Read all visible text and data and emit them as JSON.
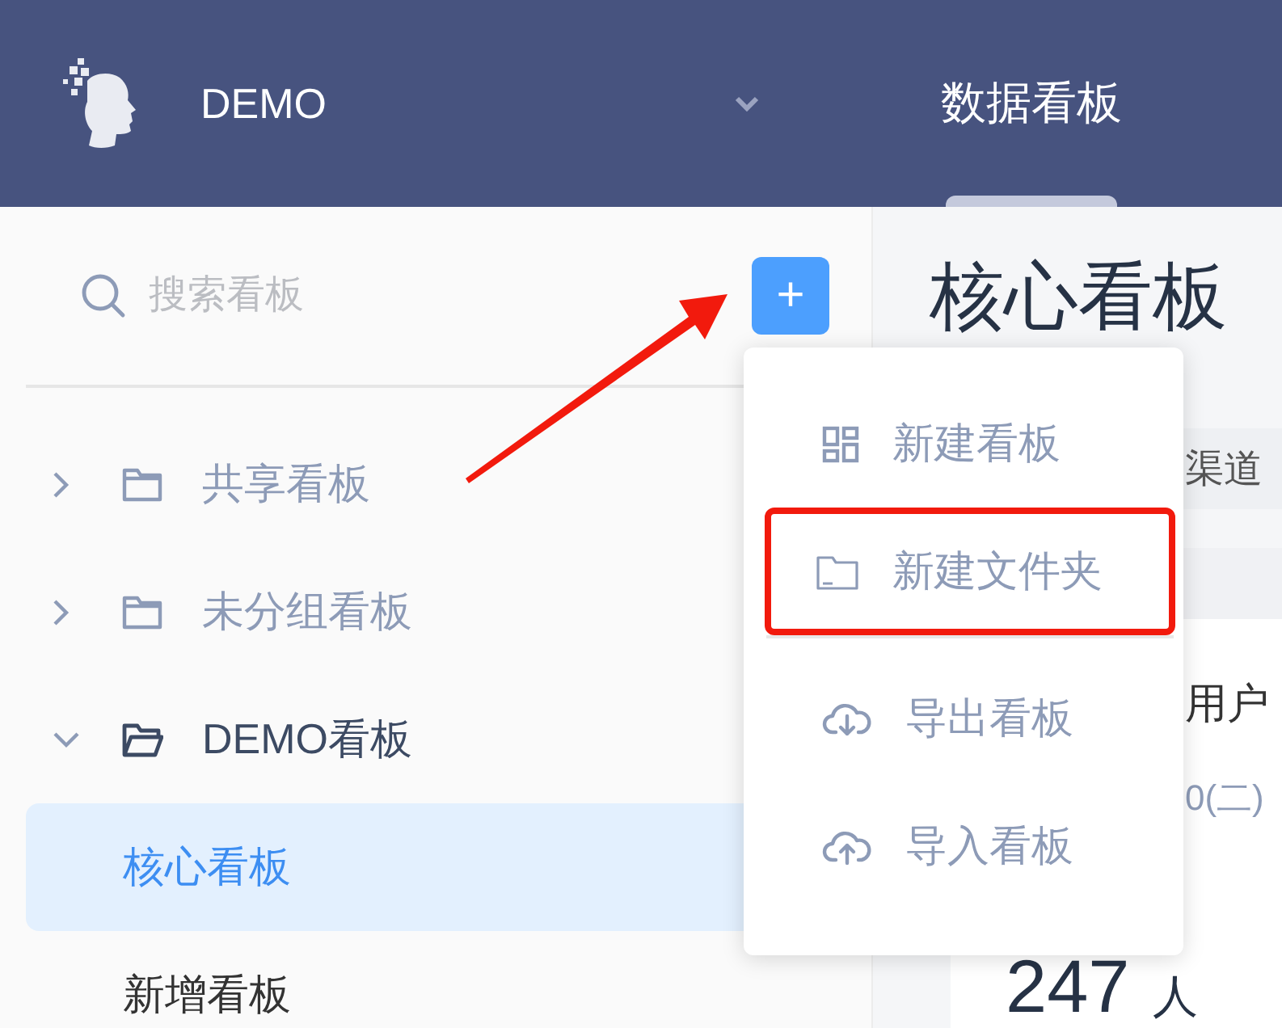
{
  "header": {
    "app_name": "DEMO",
    "tabs": [
      {
        "label": "数据看板",
        "selected": true
      }
    ]
  },
  "sidebar": {
    "search": {
      "placeholder": "搜索看板"
    },
    "add_button": "+",
    "tree": [
      {
        "label": "共享看板",
        "expanded": false
      },
      {
        "label": "未分组看板",
        "expanded": false
      },
      {
        "label": "DEMO看板",
        "expanded": true,
        "children": [
          {
            "label": "核心看板",
            "selected": true
          },
          {
            "label": "新增看板",
            "selected": false
          }
        ]
      }
    ]
  },
  "main": {
    "title": "核心看板",
    "filter_text": "渠道",
    "card_title": "用户",
    "card_date": "0(二)",
    "card_value": "247",
    "card_unit": "人"
  },
  "menu": {
    "sections": [
      [
        {
          "kind": "board",
          "label": "新建看板",
          "highlighted": false
        },
        {
          "kind": "folder",
          "label": "新建文件夹",
          "highlighted": true
        }
      ],
      [
        {
          "kind": "export",
          "label": "导出看板",
          "highlighted": false
        },
        {
          "kind": "import",
          "label": "导入看板",
          "highlighted": false
        }
      ]
    ]
  }
}
